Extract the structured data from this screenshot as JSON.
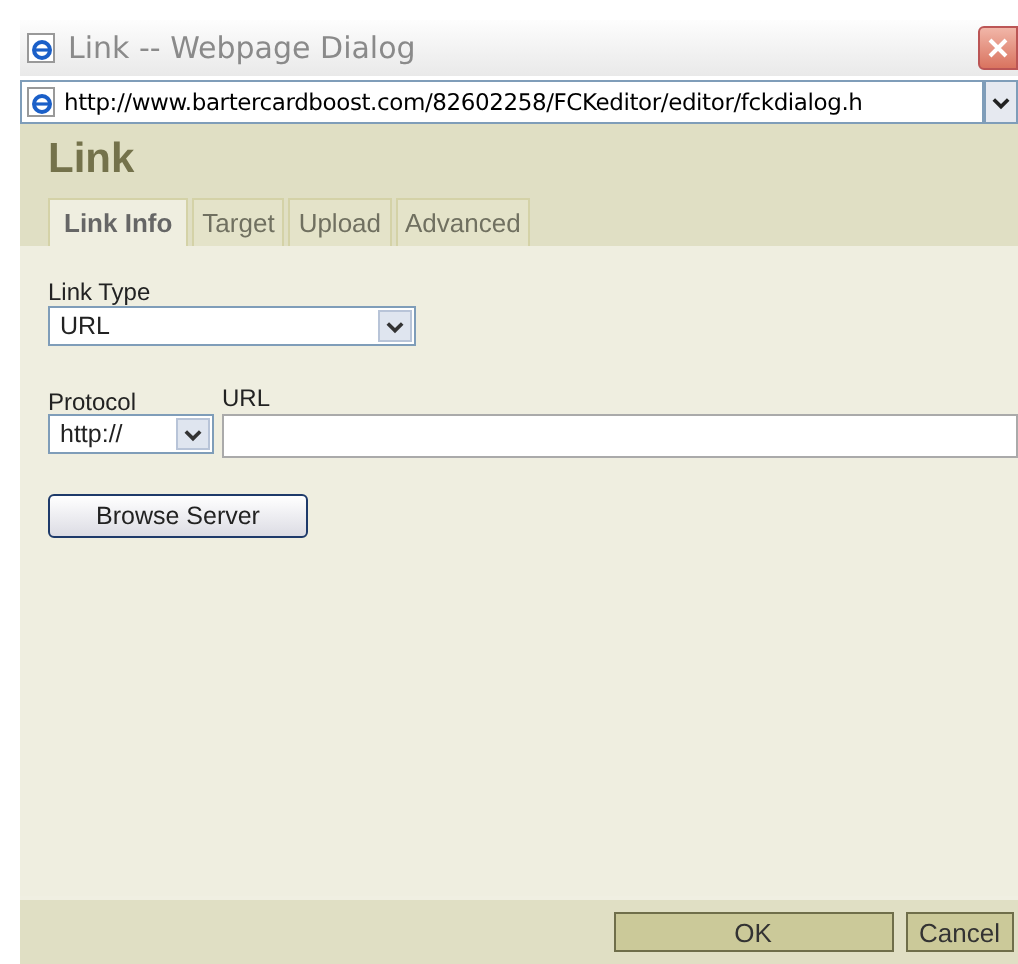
{
  "window": {
    "title": "Link -- Webpage Dialog",
    "address": "http://www.bartercardboost.com/82602258/FCKeditor/editor/fckdialog.h"
  },
  "dialog": {
    "title": "Link"
  },
  "tabs": [
    {
      "label": "Link Info",
      "selected": true
    },
    {
      "label": "Target",
      "selected": false
    },
    {
      "label": "Upload",
      "selected": false
    },
    {
      "label": "Advanced",
      "selected": false
    }
  ],
  "link_type": {
    "label": "Link Type",
    "value": "URL"
  },
  "protocol": {
    "label": "Protocol",
    "value": "http://"
  },
  "url": {
    "label": "URL"
  },
  "browse_button": "Browse Server",
  "buttons": [
    "OK",
    "Cancel"
  ]
}
